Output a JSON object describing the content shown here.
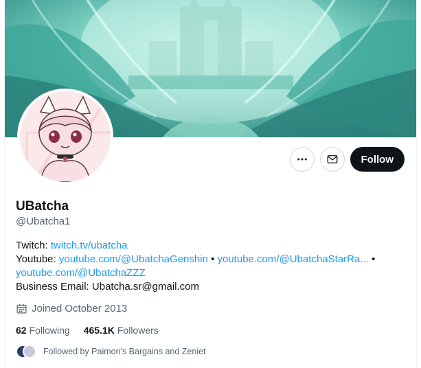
{
  "profile": {
    "display_name": "UBatcha",
    "handle": "@Ubatcha1",
    "follow_label": "Follow"
  },
  "bio": {
    "twitch_label": "Twitch:",
    "twitch_link": "twitch.tv/ubatcha",
    "youtube_label": "Youtube:",
    "youtube_link_1": "youtube.com/@UbatchaGenshin",
    "youtube_link_2": "youtube.com/@UbatchaStarRa...",
    "youtube_link_3": "youtube.com/@UbatchaZZZ",
    "separator": "•",
    "email_label": "Business Email:",
    "email_value": "Ubatcha.sr@gmail.com"
  },
  "meta": {
    "joined": "Joined October 2013"
  },
  "stats": {
    "following_count": "62",
    "following_label": "Following",
    "followers_count": "465.1K",
    "followers_label": "Followers"
  },
  "followed_by": {
    "text": "Followed by Paimon's Bargains and Zeniet"
  },
  "icons": {
    "more": "more-icon",
    "message": "mail-icon",
    "calendar": "calendar-icon"
  },
  "colors": {
    "accent_link": "#1d9bf0",
    "follow_button": "#0f1419",
    "muted_text": "#536471"
  }
}
